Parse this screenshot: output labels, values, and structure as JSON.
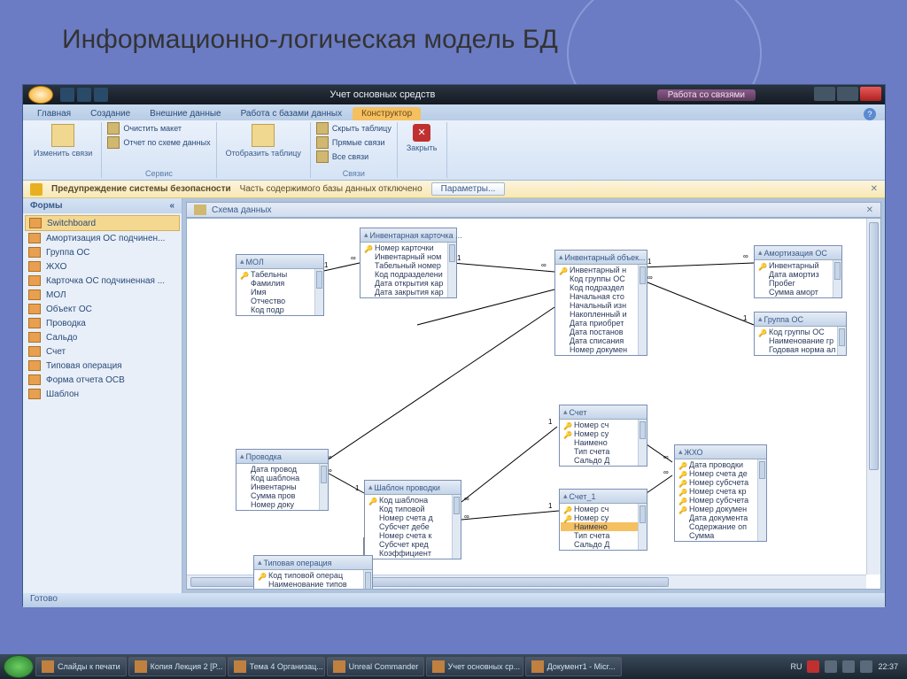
{
  "slide": {
    "title": "Информационно-логическая модель БД"
  },
  "window": {
    "app_title": "Учет основных средств",
    "contextual_title": "Работа со связями"
  },
  "ribbon": {
    "tabs": [
      "Главная",
      "Создание",
      "Внешние данные",
      "Работа с базами данных",
      "Конструктор"
    ],
    "groups": {
      "g1": {
        "big": "Изменить связи",
        "items": [
          "Очистить макет",
          "Отчет по схеме данных"
        ],
        "name": "Сервис"
      },
      "g2": {
        "big": "Отобразить таблицу",
        "items": [
          "Скрыть таблицу",
          "Прямые связи",
          "Все связи"
        ],
        "name": "Связи"
      },
      "g3": {
        "big": "Закрыть"
      }
    }
  },
  "security": {
    "label": "Предупреждение системы безопасности",
    "msg": "Часть содержимого базы данных отключено",
    "button": "Параметры..."
  },
  "nav": {
    "header": "Формы",
    "items": [
      "Switchboard",
      "Амортизация ОС подчинен...",
      "Группа ОС",
      "ЖХО",
      "Карточка ОС подчиненная ...",
      "МОЛ",
      "Объект ОС",
      "Проводка",
      "Сальдо",
      "Счет",
      "Типовая операция",
      "Форма отчета ОСВ",
      "Шаблон"
    ]
  },
  "canvas": {
    "title": "Схема данных"
  },
  "tables": {
    "mol": {
      "title": "МОЛ",
      "fields": [
        "Табельны",
        "Фамилия",
        "Имя",
        "Отчество",
        "Код подр"
      ],
      "keys": [
        0
      ]
    },
    "card": {
      "title": "Инвентарная карточка ...",
      "fields": [
        "Номер карточки",
        "Инвентарный ном",
        "Табельный номер",
        "Код подразделени",
        "Дата открытия кар",
        "Дата закрытия кар"
      ],
      "keys": [
        0
      ]
    },
    "obj": {
      "title": "Инвентарный объек...",
      "fields": [
        "Инвентарный н",
        "Код группы ОС",
        "Код подраздел",
        "Начальная сто",
        "Начальный изн",
        "Накопленный и",
        "Дата приобрет",
        "Дата постанов",
        "Дата списания",
        "Номер докумен"
      ],
      "keys": [
        0
      ]
    },
    "amort": {
      "title": "Амортизация ОС",
      "fields": [
        "Инвентарный",
        "Дата амортиз",
        "Пробег",
        "Сумма аморт"
      ],
      "keys": [
        0
      ]
    },
    "group": {
      "title": "Группа ОС",
      "fields": [
        "Код группы ОС",
        "Наименование гр",
        "Годовая норма ал"
      ],
      "keys": [
        0
      ]
    },
    "schet": {
      "title": "Счет",
      "fields": [
        "Номер сч",
        "Номер су",
        "Наимено",
        "Тип счета",
        "Сальдо Д"
      ],
      "keys": [
        0,
        1
      ]
    },
    "schet1": {
      "title": "Счет_1",
      "fields": [
        "Номер сч",
        "Номер су",
        "Наимено",
        "Тип счета",
        "Сальдо Д"
      ],
      "keys": [
        0,
        1
      ]
    },
    "jho": {
      "title": "ЖХО",
      "fields": [
        "Дата проводки",
        "Номер счета де",
        "Номер субсчета",
        "Номер счета кр",
        "Номер субсчета",
        "Номер докумен",
        "Дата документа",
        "Содержание оп",
        "Сумма"
      ],
      "keys": [
        0,
        1,
        2,
        3,
        4,
        5
      ]
    },
    "prov": {
      "title": "Проводка",
      "fields": [
        "Дата провод",
        "Код шаблона",
        "Инвентарны",
        "Сумма пров",
        "Номер доку"
      ],
      "keys": []
    },
    "shab": {
      "title": "Шаблон проводки",
      "fields": [
        "Код шаблона",
        "Код типовой",
        "Номер счета д",
        "Субсчет дебе",
        "Номер счета к",
        "Субсчет кред",
        "Коэффициент"
      ],
      "keys": [
        0
      ]
    },
    "typop": {
      "title": "Типовая операция",
      "fields": [
        "Код типовой операц",
        "Наименование типов"
      ],
      "keys": [
        0
      ]
    }
  },
  "rel_labels": {
    "one": "1",
    "many": "∞"
  },
  "statusbar": "Готово",
  "taskbar": {
    "items": [
      "Слайды к печати",
      "Копия Лекция 2 [Р...",
      "Тема 4 Организац...",
      "Unreal Commander",
      "Учет основных ср...",
      "Документ1 - Micr..."
    ],
    "lang": "RU",
    "time": "22:37"
  }
}
